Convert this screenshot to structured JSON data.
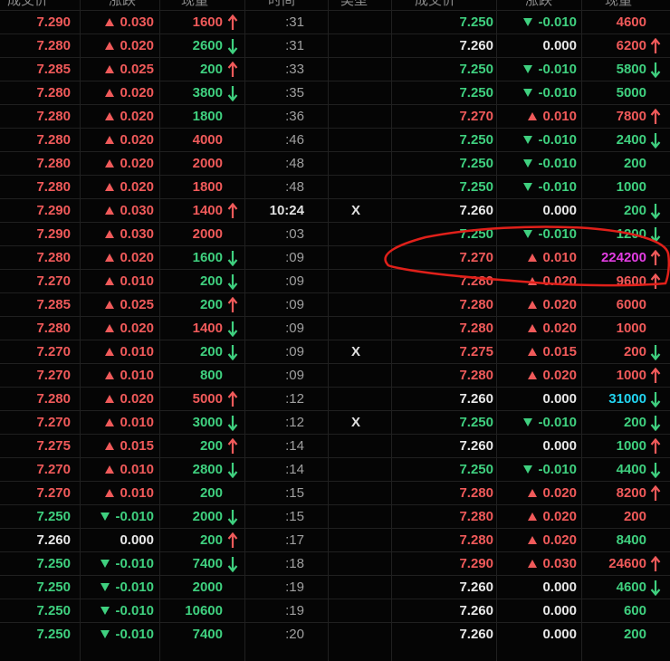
{
  "headers": {
    "left": [
      "成交价",
      "涨跌",
      "现量",
      "时间",
      "类型"
    ],
    "right": [
      "成交价",
      "涨跌",
      "现量"
    ]
  },
  "colors": {
    "up": "#f05a5a",
    "down": "#3fd07f",
    "flat": "#e8e8e8",
    "highlight_magenta": "#e23de2",
    "highlight_cyan": "#22d4f0",
    "annotation": "#e0201a"
  },
  "left_rows": [
    {
      "price": "7.290",
      "change": "0.030",
      "dir": "up",
      "vol": "1600",
      "voldir": "up",
      "arrow": "up",
      "time": ":31",
      "type": ""
    },
    {
      "price": "7.280",
      "change": "0.020",
      "dir": "up",
      "vol": "2600",
      "voldir": "dn",
      "arrow": "dn",
      "time": ":31",
      "type": ""
    },
    {
      "price": "7.285",
      "change": "0.025",
      "dir": "up",
      "vol": "200",
      "voldir": "dn",
      "arrow": "up",
      "time": ":33",
      "type": ""
    },
    {
      "price": "7.280",
      "change": "0.020",
      "dir": "up",
      "vol": "3800",
      "voldir": "dn",
      "arrow": "dn",
      "time": ":35",
      "type": ""
    },
    {
      "price": "7.280",
      "change": "0.020",
      "dir": "up",
      "vol": "1800",
      "voldir": "dn",
      "arrow": "",
      "time": ":36",
      "type": ""
    },
    {
      "price": "7.280",
      "change": "0.020",
      "dir": "up",
      "vol": "4000",
      "voldir": "up",
      "arrow": "",
      "time": ":46",
      "type": ""
    },
    {
      "price": "7.280",
      "change": "0.020",
      "dir": "up",
      "vol": "2000",
      "voldir": "up",
      "arrow": "",
      "time": ":48",
      "type": ""
    },
    {
      "price": "7.280",
      "change": "0.020",
      "dir": "up",
      "vol": "1800",
      "voldir": "up",
      "arrow": "",
      "time": ":48",
      "type": ""
    },
    {
      "price": "7.290",
      "change": "0.030",
      "dir": "up",
      "vol": "1400",
      "voldir": "up",
      "arrow": "up",
      "time": "10:24",
      "type": "X"
    },
    {
      "price": "7.290",
      "change": "0.030",
      "dir": "up",
      "vol": "2000",
      "voldir": "up",
      "arrow": "",
      "time": ":03",
      "type": ""
    },
    {
      "price": "7.280",
      "change": "0.020",
      "dir": "up",
      "vol": "1600",
      "voldir": "dn",
      "arrow": "dn",
      "time": ":09",
      "type": ""
    },
    {
      "price": "7.270",
      "change": "0.010",
      "dir": "up",
      "vol": "200",
      "voldir": "dn",
      "arrow": "dn",
      "time": ":09",
      "type": ""
    },
    {
      "price": "7.285",
      "change": "0.025",
      "dir": "up",
      "vol": "200",
      "voldir": "dn",
      "arrow": "up",
      "time": ":09",
      "type": ""
    },
    {
      "price": "7.280",
      "change": "0.020",
      "dir": "up",
      "vol": "1400",
      "voldir": "up",
      "arrow": "dn",
      "time": ":09",
      "type": ""
    },
    {
      "price": "7.270",
      "change": "0.010",
      "dir": "up",
      "vol": "200",
      "voldir": "dn",
      "arrow": "dn",
      "time": ":09",
      "type": "X"
    },
    {
      "price": "7.270",
      "change": "0.010",
      "dir": "up",
      "vol": "800",
      "voldir": "dn",
      "arrow": "",
      "time": ":09",
      "type": ""
    },
    {
      "price": "7.280",
      "change": "0.020",
      "dir": "up",
      "vol": "5000",
      "voldir": "up",
      "arrow": "up",
      "time": ":12",
      "type": ""
    },
    {
      "price": "7.270",
      "change": "0.010",
      "dir": "up",
      "vol": "3000",
      "voldir": "dn",
      "arrow": "dn",
      "time": ":12",
      "type": "X"
    },
    {
      "price": "7.275",
      "change": "0.015",
      "dir": "up",
      "vol": "200",
      "voldir": "dn",
      "arrow": "up",
      "time": ":14",
      "type": ""
    },
    {
      "price": "7.270",
      "change": "0.010",
      "dir": "up",
      "vol": "2800",
      "voldir": "dn",
      "arrow": "dn",
      "time": ":14",
      "type": ""
    },
    {
      "price": "7.270",
      "change": "0.010",
      "dir": "up",
      "vol": "200",
      "voldir": "dn",
      "arrow": "",
      "time": ":15",
      "type": ""
    },
    {
      "price": "7.250",
      "change": "-0.010",
      "dir": "dn",
      "vol": "2000",
      "voldir": "dn",
      "arrow": "dn",
      "time": ":15",
      "type": ""
    },
    {
      "price": "7.260",
      "change": "0.000",
      "dir": "flat",
      "vol": "200",
      "voldir": "dn",
      "arrow": "up",
      "time": ":17",
      "type": ""
    },
    {
      "price": "7.250",
      "change": "-0.010",
      "dir": "dn",
      "vol": "7400",
      "voldir": "dn",
      "arrow": "dn",
      "time": ":18",
      "type": ""
    },
    {
      "price": "7.250",
      "change": "-0.010",
      "dir": "dn",
      "vol": "2000",
      "voldir": "dn",
      "arrow": "",
      "time": ":19",
      "type": ""
    },
    {
      "price": "7.250",
      "change": "-0.010",
      "dir": "dn",
      "vol": "10600",
      "voldir": "dn",
      "arrow": "",
      "time": ":19",
      "type": ""
    },
    {
      "price": "7.250",
      "change": "-0.010",
      "dir": "dn",
      "vol": "7400",
      "voldir": "dn",
      "arrow": "",
      "time": ":20",
      "type": ""
    }
  ],
  "right_rows": [
    {
      "price": "7.250",
      "change": "-0.010",
      "dir": "dn",
      "vol": "4600",
      "voldir": "up",
      "arrow": ""
    },
    {
      "price": "7.260",
      "change": "0.000",
      "dir": "flat",
      "vol": "6200",
      "voldir": "up",
      "arrow": "up"
    },
    {
      "price": "7.250",
      "change": "-0.010",
      "dir": "dn",
      "vol": "5800",
      "voldir": "dn",
      "arrow": "dn"
    },
    {
      "price": "7.250",
      "change": "-0.010",
      "dir": "dn",
      "vol": "5000",
      "voldir": "dn",
      "arrow": ""
    },
    {
      "price": "7.270",
      "change": "0.010",
      "dir": "up",
      "vol": "7800",
      "voldir": "up",
      "arrow": "up"
    },
    {
      "price": "7.250",
      "change": "-0.010",
      "dir": "dn",
      "vol": "2400",
      "voldir": "dn",
      "arrow": "dn"
    },
    {
      "price": "7.250",
      "change": "-0.010",
      "dir": "dn",
      "vol": "200",
      "voldir": "dn",
      "arrow": ""
    },
    {
      "price": "7.250",
      "change": "-0.010",
      "dir": "dn",
      "vol": "1000",
      "voldir": "dn",
      "arrow": ""
    },
    {
      "price": "7.260",
      "change": "0.000",
      "dir": "flat",
      "vol": "200",
      "voldir": "dn",
      "arrow": "dn"
    },
    {
      "price": "7.250",
      "change": "-0.010",
      "dir": "dn",
      "vol": "1200",
      "voldir": "dn",
      "arrow": "dn"
    },
    {
      "price": "7.270",
      "change": "0.010",
      "dir": "up",
      "vol": "224200",
      "voldir": "magenta",
      "arrow": "up"
    },
    {
      "price": "7.280",
      "change": "0.020",
      "dir": "up",
      "vol": "9600",
      "voldir": "up",
      "arrow": "up"
    },
    {
      "price": "7.280",
      "change": "0.020",
      "dir": "up",
      "vol": "6000",
      "voldir": "up",
      "arrow": ""
    },
    {
      "price": "7.280",
      "change": "0.020",
      "dir": "up",
      "vol": "1000",
      "voldir": "up",
      "arrow": ""
    },
    {
      "price": "7.275",
      "change": "0.015",
      "dir": "up",
      "vol": "200",
      "voldir": "up",
      "arrow": "dn"
    },
    {
      "price": "7.280",
      "change": "0.020",
      "dir": "up",
      "vol": "1000",
      "voldir": "up",
      "arrow": "up"
    },
    {
      "price": "7.260",
      "change": "0.000",
      "dir": "flat",
      "vol": "31000",
      "voldir": "cyan",
      "arrow": "dn"
    },
    {
      "price": "7.250",
      "change": "-0.010",
      "dir": "dn",
      "vol": "200",
      "voldir": "dn",
      "arrow": "dn"
    },
    {
      "price": "7.260",
      "change": "0.000",
      "dir": "flat",
      "vol": "1000",
      "voldir": "dn",
      "arrow": "up"
    },
    {
      "price": "7.250",
      "change": "-0.010",
      "dir": "dn",
      "vol": "4400",
      "voldir": "dn",
      "arrow": "dn"
    },
    {
      "price": "7.280",
      "change": "0.020",
      "dir": "up",
      "vol": "8200",
      "voldir": "up",
      "arrow": "up"
    },
    {
      "price": "7.280",
      "change": "0.020",
      "dir": "up",
      "vol": "200",
      "voldir": "up",
      "arrow": ""
    },
    {
      "price": "7.280",
      "change": "0.020",
      "dir": "up",
      "vol": "8400",
      "voldir": "dn",
      "arrow": ""
    },
    {
      "price": "7.290",
      "change": "0.030",
      "dir": "up",
      "vol": "24600",
      "voldir": "up",
      "arrow": "up"
    },
    {
      "price": "7.260",
      "change": "0.000",
      "dir": "flat",
      "vol": "4600",
      "voldir": "dn",
      "arrow": "dn"
    },
    {
      "price": "7.260",
      "change": "0.000",
      "dir": "flat",
      "vol": "600",
      "voldir": "dn",
      "arrow": ""
    },
    {
      "price": "7.260",
      "change": "0.000",
      "dir": "flat",
      "vol": "200",
      "voldir": "dn",
      "arrow": ""
    }
  ]
}
